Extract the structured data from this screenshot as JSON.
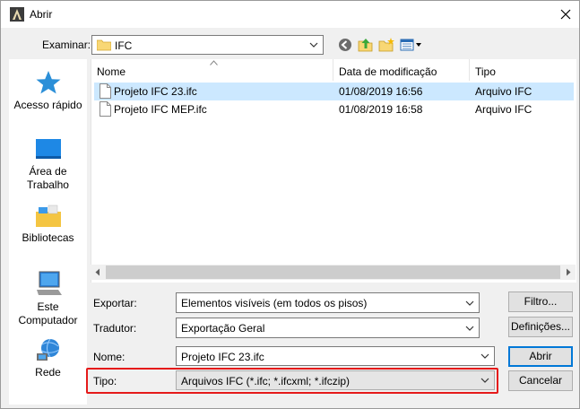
{
  "window": {
    "title": "Abrir"
  },
  "toolbar": {
    "look_in_label": "Examinar:",
    "look_in_value": "IFC"
  },
  "places": [
    {
      "label": "Acesso rápido",
      "icon": "star-icon"
    },
    {
      "label": "Área de Trabalho",
      "icon": "desktop-icon"
    },
    {
      "label": "Bibliotecas",
      "icon": "libraries-icon"
    },
    {
      "label": "Este Computador",
      "icon": "computer-icon"
    },
    {
      "label": "Rede",
      "icon": "network-icon"
    }
  ],
  "filelist": {
    "columns": [
      "Nome",
      "Data de modificação",
      "Tipo"
    ],
    "rows": [
      {
        "name": "Projeto IFC 23.ifc",
        "date": "01/08/2019 16:56",
        "type": "Arquivo IFC",
        "selected": true
      },
      {
        "name": "Projeto IFC MEP.ifc",
        "date": "01/08/2019 16:58",
        "type": "Arquivo IFC",
        "selected": false
      }
    ]
  },
  "options": {
    "export_label": "Exportar:",
    "export_value": "Elementos visíveis (em todos os pisos)",
    "translator_label": "Tradutor:",
    "translator_value": "Exportação Geral",
    "filter_button": "Filtro...",
    "settings_button": "Definições...",
    "name_label": "Nome:",
    "name_value": "Projeto IFC 23.ifc",
    "type_label": "Tipo:",
    "type_value": "Arquivos IFC (*.ifc; *.ifcxml; *.ifczip)",
    "open_button": "Abrir",
    "cancel_button": "Cancelar"
  },
  "colors": {
    "selection": "#cce8ff",
    "highlight_border": "#e51a1a",
    "default_button_border": "#0078d7"
  }
}
